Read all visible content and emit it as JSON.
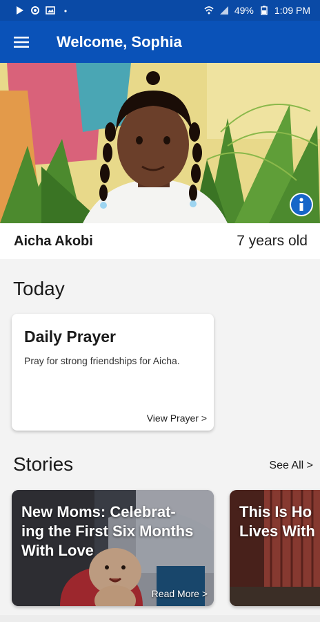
{
  "status_bar": {
    "battery": "49%",
    "time": "1:09 PM",
    "left_icons": [
      "media-icon",
      "sync-icon",
      "image-icon",
      "dot-icon"
    ],
    "right_icons": [
      "wifi-icon",
      "signal-icon",
      "battery-icon"
    ]
  },
  "app_bar": {
    "title": "Welcome, Sophia",
    "menu_icon": "menu-icon"
  },
  "child": {
    "name": "Aicha Akobi",
    "age": "7 years old",
    "info_icon": "info-icon"
  },
  "today": {
    "heading": "Today",
    "prayer_card": {
      "title": "Daily Prayer",
      "text": "Pray for strong friendships for Aicha.",
      "link": "View Prayer >"
    }
  },
  "stories": {
    "heading": "Stories",
    "see_all": "See All >",
    "items": [
      {
        "title": "New Moms: Celebrat-ing the First Six Months With Love",
        "title_lines": [
          "New Moms: Celebrat-",
          "ing the First Six Months",
          "With Love"
        ],
        "link": "Read More >"
      },
      {
        "title": "This Is Ho Lives With",
        "title_lines": [
          "This Is Ho",
          "Lives With"
        ]
      }
    ]
  },
  "colors": {
    "status_bar": "#0a4aa6",
    "app_bar": "#0a52b8",
    "info_button": "#1766c8",
    "background": "#f3f3f3"
  }
}
